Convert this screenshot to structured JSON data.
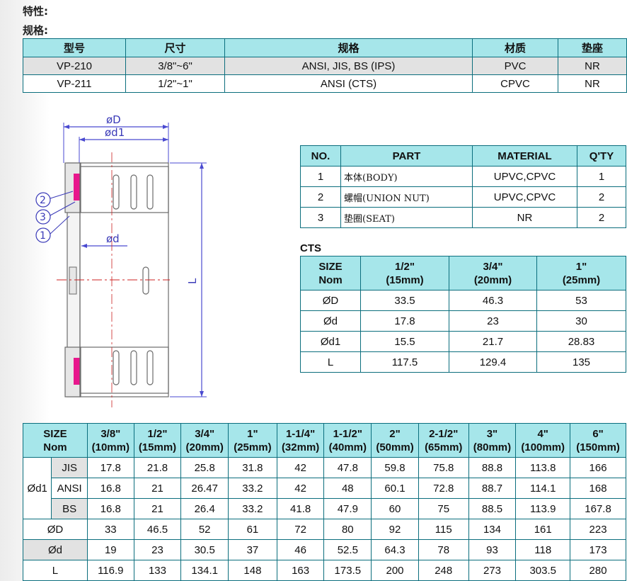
{
  "headings": {
    "features": "特性:",
    "specs": "规格:"
  },
  "spec_table": {
    "headers": [
      "型号",
      "尺寸",
      "规格",
      "材质",
      "垫座"
    ],
    "rows": [
      [
        "VP-210",
        "3/8\"~6\"",
        "ANSI, JIS, BS (IPS)",
        "PVC",
        "NR"
      ],
      [
        "VP-211",
        "1/2\"~1\"",
        "ANSI (CTS)",
        "CPVC",
        "NR"
      ]
    ]
  },
  "drawing": {
    "labels": {
      "D": "øD",
      "d1": "ød1",
      "d": "ød",
      "L": "L"
    },
    "callouts": [
      "2",
      "3",
      "1"
    ],
    "colors": {
      "line": "#4a4ad0",
      "body": "#6b6b6b",
      "seat": "#e8168c",
      "fill": "#f2f2f2"
    }
  },
  "parts_table": {
    "headers": [
      "NO.",
      "PART",
      "MATERIAL",
      "Q'TY"
    ],
    "rows": [
      [
        "1",
        "本体(BODY)",
        "UPVC,CPVC",
        "1"
      ],
      [
        "2",
        "螺帽(UNION NUT)",
        "UPVC,CPVC",
        "2"
      ],
      [
        "3",
        "垫圈(SEAT)",
        "NR",
        "2"
      ]
    ]
  },
  "cts_table": {
    "caption": "CTS",
    "header": {
      "size_line1": "SIZE",
      "size_line2": "Nom",
      "cols": [
        {
          "line1": "1/2\"",
          "line2": "(15mm)"
        },
        {
          "line1": "3/4\"",
          "line2": "(20mm)"
        },
        {
          "line1": "1\"",
          "line2": "(25mm)"
        }
      ]
    },
    "rows": [
      {
        "label": "ØD",
        "values": [
          "33.5",
          "46.3",
          "53"
        ]
      },
      {
        "label": "Ød",
        "values": [
          "17.8",
          "23",
          "30"
        ]
      },
      {
        "label": "Ød1",
        "values": [
          "15.5",
          "21.7",
          "28.83"
        ]
      },
      {
        "label": "L",
        "values": [
          "117.5",
          "129.4",
          "135"
        ]
      }
    ]
  },
  "ips_table": {
    "header": {
      "size_line1": "SIZE",
      "size_line2": "Nom",
      "cols": [
        {
          "line1": "3/8\"",
          "line2": "(10mm)"
        },
        {
          "line1": "1/2\"",
          "line2": "(15mm)"
        },
        {
          "line1": "3/4\"",
          "line2": "(20mm)"
        },
        {
          "line1": "1\"",
          "line2": "(25mm)"
        },
        {
          "line1": "1-1/4\"",
          "line2": "(32mm)"
        },
        {
          "line1": "1-1/2\"",
          "line2": "(40mm)"
        },
        {
          "line1": "2\"",
          "line2": "(50mm)"
        },
        {
          "line1": "2-1/2\"",
          "line2": "(65mm)"
        },
        {
          "line1": "3\"",
          "line2": "(80mm)"
        },
        {
          "line1": "4\"",
          "line2": "(100mm)"
        },
        {
          "line1": "6\"",
          "line2": "(150mm)"
        }
      ]
    },
    "d1_label": "Ød1",
    "d1_rows": [
      {
        "std": "JIS",
        "values": [
          "17.8",
          "21.8",
          "25.8",
          "31.8",
          "42",
          "47.8",
          "59.8",
          "75.8",
          "88.8",
          "113.8",
          "166"
        ]
      },
      {
        "std": "ANSI",
        "values": [
          "16.8",
          "21",
          "26.47",
          "33.2",
          "42",
          "48",
          "60.1",
          "72.8",
          "88.7",
          "114.1",
          "168"
        ]
      },
      {
        "std": "BS",
        "values": [
          "16.8",
          "21",
          "26.4",
          "33.2",
          "41.8",
          "47.9",
          "60",
          "75",
          "88.5",
          "113.9",
          "167.8"
        ]
      }
    ],
    "rows": [
      {
        "label": "ØD",
        "values": [
          "33",
          "46.5",
          "52",
          "61",
          "72",
          "80",
          "92",
          "115",
          "134",
          "161",
          "223"
        ]
      },
      {
        "label": "Ød",
        "values": [
          "19",
          "23",
          "30.5",
          "37",
          "46",
          "52.5",
          "64.3",
          "78",
          "93",
          "118",
          "173"
        ]
      },
      {
        "label": "L",
        "values": [
          "116.9",
          "133",
          "134.1",
          "148",
          "163",
          "173.5",
          "200",
          "248",
          "273",
          "303.5",
          "280"
        ]
      }
    ]
  }
}
